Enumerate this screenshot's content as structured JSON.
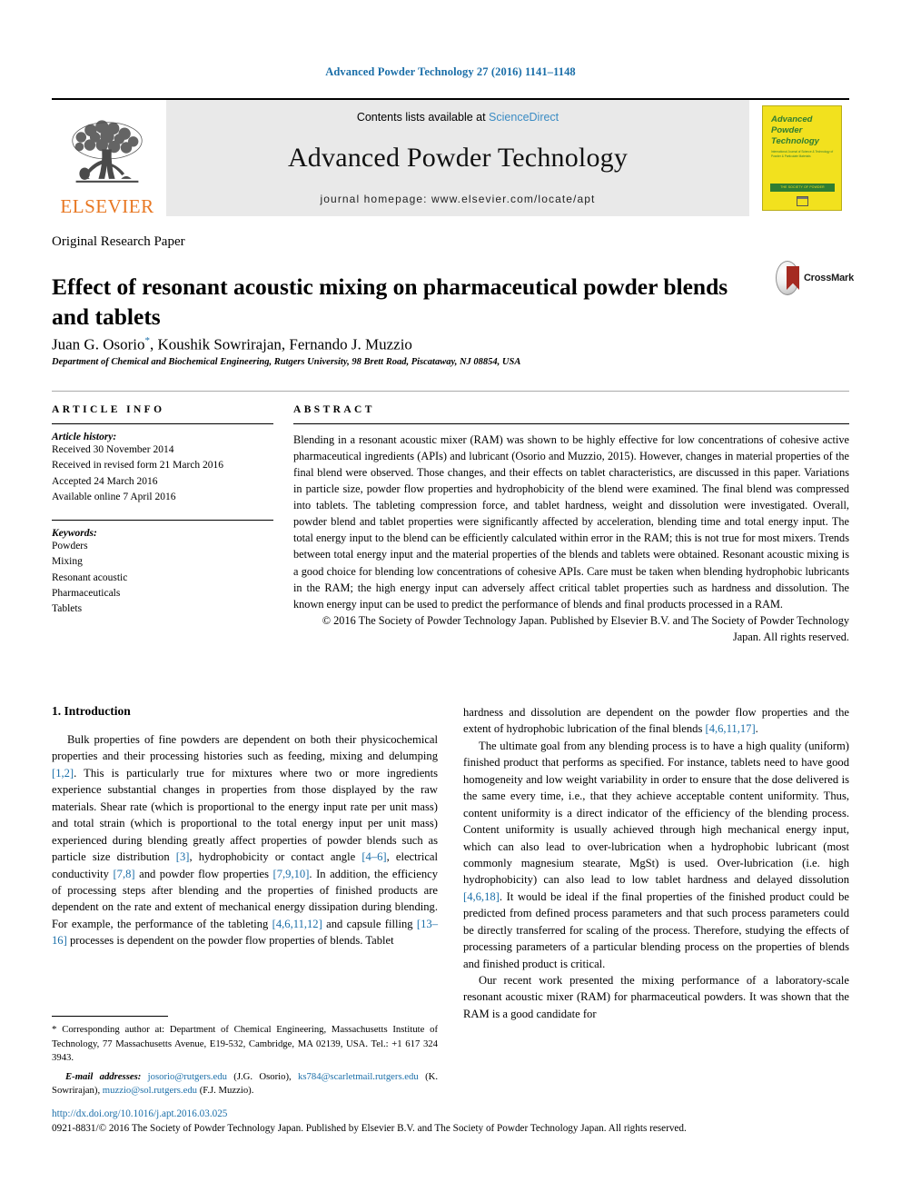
{
  "running_head": "Advanced Powder Technology 27 (2016) 1141–1148",
  "masthead": {
    "elsevier_wordmark": "ELSEVIER",
    "contents_prefix": "Contents lists available at ",
    "contents_link": "ScienceDirect",
    "journal_title": "Advanced Powder Technology",
    "homepage": "journal homepage: www.elsevier.com/locate/apt",
    "cover": {
      "line1": "Advanced",
      "line2": "Powder",
      "line3": "Technology",
      "subtitle": "International Journal of Science & Technology of Powder & Particulate Materials",
      "band": "THE SOCIETY OF POWDER TECHNOLOGY JAPAN",
      "foot": "ELSEVIER"
    }
  },
  "article": {
    "section_label": "Original Research Paper",
    "title": "Effect of resonant acoustic mixing on pharmaceutical powder blends and tablets",
    "crossmark_label": "CrossMark",
    "authors": "Juan G. Osorio, Koushik Sowrirajan, Fernando J. Muzzio",
    "author_star": "*",
    "affiliation": "Department of Chemical and Biochemical Engineering, Rutgers University, 98 Brett Road, Piscataway, NJ 08854, USA"
  },
  "article_info": {
    "heading": "ARTICLE INFO",
    "history_label": "Article history:",
    "history": [
      "Received 30 November 2014",
      "Received in revised form 21 March 2016",
      "Accepted 24 March 2016",
      "Available online 7 April 2016"
    ],
    "keywords_label": "Keywords:",
    "keywords": [
      "Powders",
      "Mixing",
      "Resonant acoustic",
      "Pharmaceuticals",
      "Tablets"
    ]
  },
  "abstract": {
    "heading": "ABSTRACT",
    "body": "Blending in a resonant acoustic mixer (RAM) was shown to be highly effective for low concentrations of cohesive active pharmaceutical ingredients (APIs) and lubricant (Osorio and Muzzio, 2015). However, changes in material properties of the final blend were observed. Those changes, and their effects on tablet characteristics, are discussed in this paper. Variations in particle size, powder flow properties and hydrophobicity of the blend were examined. The final blend was compressed into tablets. The tableting compression force, and tablet hardness, weight and dissolution were investigated. Overall, powder blend and tablet properties were significantly affected by acceleration, blending time and total energy input. The total energy input to the blend can be efficiently calculated within error in the RAM; this is not true for most mixers. Trends between total energy input and the material properties of the blends and tablets were obtained. Resonant acoustic mixing is a good choice for blending low concentrations of cohesive APIs. Care must be taken when blending hydrophobic lubricants in the RAM; the high energy input can adversely affect critical tablet properties such as hardness and dissolution. The known energy input can be used to predict the performance of blends and final products processed in a RAM.",
    "copyright": "© 2016 The Society of Powder Technology Japan. Published by Elsevier B.V. and The Society of Powder Technology Japan. All rights reserved."
  },
  "introduction": {
    "heading": "1. Introduction",
    "left_p1_a": "Bulk properties of fine powders are dependent on both their physicochemical properties and their processing histories such as feeding, mixing and delumping ",
    "ref_1_2": "[1,2]",
    "left_p1_b": ". This is particularly true for mixtures where two or more ingredients experience substantial changes in properties from those displayed by the raw materials. Shear rate (which is proportional to the energy input rate per unit mass) and total strain (which is proportional to the total energy input per unit mass) experienced during blending greatly affect properties of powder blends such as particle size distribution ",
    "ref_3": "[3]",
    "left_p1_c": ", hydrophobicity or contact angle ",
    "ref_4_6": "[4–6]",
    "left_p1_d": ", electrical conductivity ",
    "ref_7_8": "[7,8]",
    "left_p1_e": " and powder flow properties ",
    "ref_7_9_10": "[7,9,10]",
    "left_p1_f": ". In addition, the efficiency of processing steps after blending and the properties of finished products are dependent on the rate and extent of mechanical energy dissipation during blending. For example, the performance of the tableting ",
    "ref_4_6_11_12": "[4,6,11,12]",
    "left_p1_g": " and capsule filling ",
    "ref_13_16": "[13–16]",
    "left_p1_h": " processes is dependent on the powder flow properties of blends. Tablet",
    "right_p1_a": "hardness and dissolution are dependent on the powder flow properties and the extent of hydrophobic lubrication of the final blends ",
    "ref_4_6_11_17": "[4,6,11,17]",
    "right_p1_b": ".",
    "right_p2_a": "The ultimate goal from any blending process is to have a high quality (uniform) finished product that performs as specified. For instance, tablets need to have good homogeneity and low weight variability in order to ensure that the dose delivered is the same every time, i.e., that they achieve acceptable content uniformity. Thus, content uniformity is a direct indicator of the efficiency of the blending process. Content uniformity is usually achieved through high mechanical energy input, which can also lead to over-lubrication when a hydrophobic lubricant (most commonly magnesium stearate, MgSt) is used. Over-lubrication (i.e. high hydrophobicity) can also lead to low tablet hardness and delayed dissolution ",
    "ref_4_6_18": "[4,6,18]",
    "right_p2_b": ". It would be ideal if the final properties of the finished product could be predicted from defined process parameters and that such process parameters could be directly transferred for scaling of the process. Therefore, studying the effects of processing parameters of a particular blending process on the properties of blends and finished product is critical.",
    "right_p3": "Our recent work presented the mixing performance of a laboratory-scale resonant acoustic mixer (RAM) for pharmaceutical powders. It was shown that the RAM is a good candidate for"
  },
  "footnote": {
    "star": "*",
    "corresponding_a": " Corresponding author at: Department of Chemical Engineering, Massachusetts Institute of Technology, 77 Massachusetts Avenue, E19-532, Cambridge, MA 02139, USA. Tel.: +1 617 324 3943.",
    "emails_label": "E-mail addresses:",
    "email1": "josorio@rutgers.edu",
    "email1_owner": " (J.G. Osorio), ",
    "email2": "ks784@scarletmail.rutgers.edu",
    "email2_owner": " (K. Sowrirajan), ",
    "email3": "muzzio@sol.rutgers.edu",
    "email3_owner": " (F.J. Muzzio)."
  },
  "bottom": {
    "doi": "http://dx.doi.org/10.1016/j.apt.2016.03.025",
    "issn": "0921-8831/© 2016 The Society of Powder Technology Japan. Published by Elsevier B.V. and The Society of Powder Technology Japan. All rights reserved."
  },
  "colors": {
    "link_blue": "#1a6ea8",
    "elsevier_orange": "#e87722",
    "cover_yellow": "#f2e11e",
    "cover_green": "#2f7d32",
    "crossmark_red": "#a52a21"
  }
}
